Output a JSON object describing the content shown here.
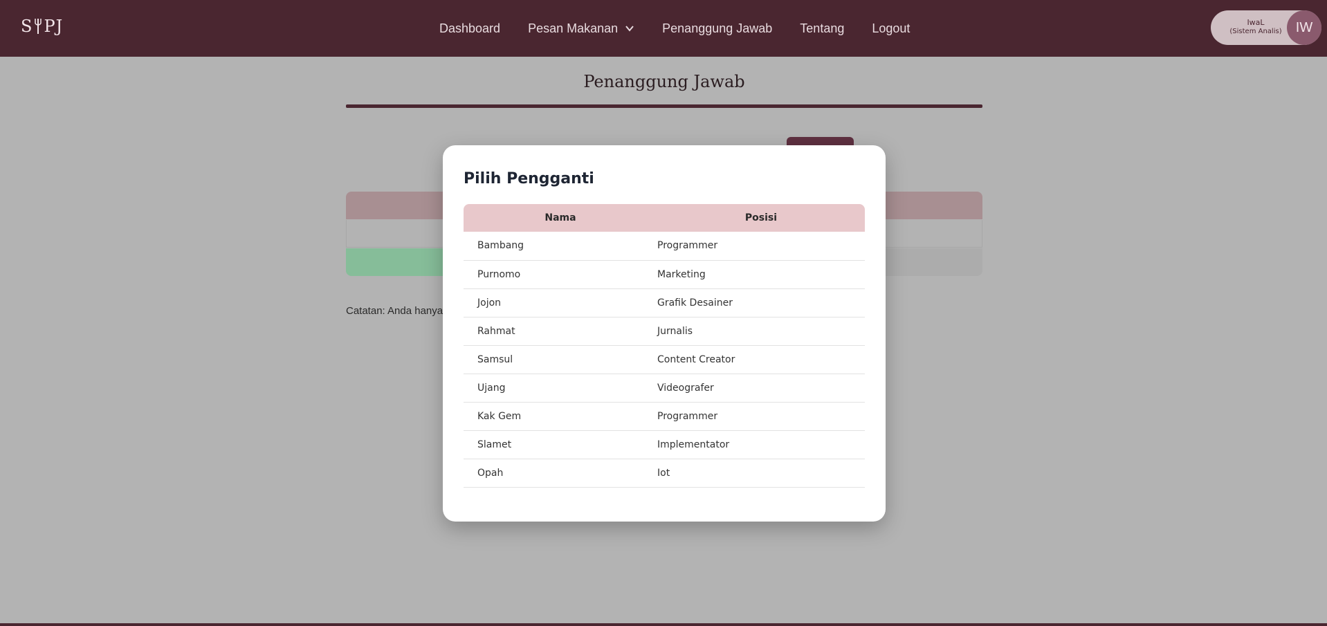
{
  "navbar": {
    "logo": "SIPJ",
    "links": [
      "Dashboard",
      "Pesan Makanan",
      "Penanggung Jawab",
      "Tentang",
      "Logout"
    ],
    "user": {
      "name": "IwaL",
      "role": "(Sistem Analis)",
      "initials": "IW"
    }
  },
  "page": {
    "title": "Penanggung Jawab",
    "note": "Catatan: Anda hanya"
  },
  "modal": {
    "title": "Pilih Pengganti",
    "columns": [
      "Nama",
      "Posisi"
    ],
    "rows": [
      {
        "nama": "Bambang",
        "posisi": "Programmer"
      },
      {
        "nama": "Purnomo",
        "posisi": "Marketing"
      },
      {
        "nama": "Jojon",
        "posisi": "Grafik Desainer"
      },
      {
        "nama": "Rahmat",
        "posisi": "Jurnalis"
      },
      {
        "nama": "Samsul",
        "posisi": "Content Creator"
      },
      {
        "nama": "Ujang",
        "posisi": "Videografer"
      },
      {
        "nama": "Kak Gem",
        "posisi": "Programmer"
      },
      {
        "nama": "Slamet",
        "posisi": "Implementator"
      },
      {
        "nama": "Opah",
        "posisi": "Iot"
      }
    ]
  },
  "colors": {
    "navbar": "#4a2630",
    "table_header": "#e8c8cb",
    "overlay": "#b3b3b3",
    "accent_green": "#86bd99"
  }
}
